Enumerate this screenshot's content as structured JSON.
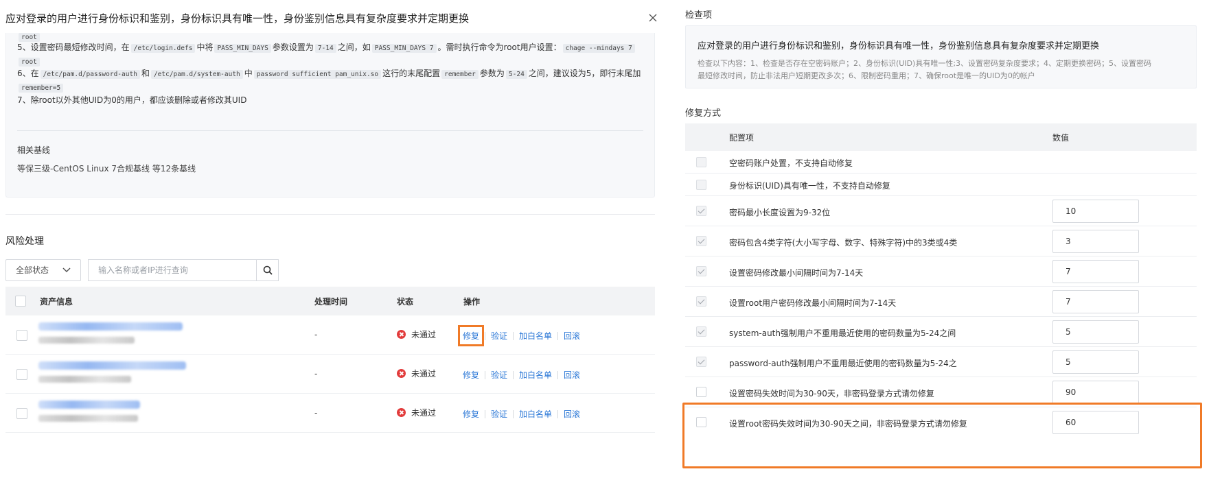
{
  "dialog": {
    "title": "应对登录的用户进行身份标识和鉴别，身份标识具有唯一性，身份鉴别信息具有复杂度要求并定期更换"
  },
  "description": {
    "line0_fragment": "root",
    "line5": {
      "p1": "5、设置密码最短修改时间，在",
      "c1": "/etc/login.defs",
      "p2": "中将",
      "c2": "PASS_MIN_DAYS",
      "p3": "参数设置为",
      "c3": "7-14",
      "p4": "之间，如",
      "c4": "PASS_MIN_DAYS 7",
      "p5": "。需时执行命令为root用户设置：",
      "c5": "chage --mindays 7",
      "c6": "root"
    },
    "line6": {
      "p1": "6、在",
      "c1": "/etc/pam.d/password-auth",
      "p2": "和",
      "c2": "/etc/pam.d/system-auth",
      "p3": "中",
      "c3": "password sufficient pam_unix.so",
      "p4": "这行的末尾配置",
      "c4": "remember",
      "p5": "参数为",
      "c5": "5-24",
      "p6": "之间，建议设为5，即行末尾加",
      "c6": "remember=5"
    },
    "line7": "7、除root以外其他UID为0的用户，都应该删除或者修改其UID",
    "baseline_title": "相关基线",
    "baseline_value": "等保三级-CentOS Linux 7合规基线 等12条基线"
  },
  "risk": {
    "title": "风险处理",
    "status_filter": "全部状态",
    "search_placeholder": "输入名称或者IP进行查询",
    "columns": [
      "资产信息",
      "处理时间",
      "状态",
      "操作"
    ],
    "rows": [
      {
        "time": "-",
        "status": "未通过"
      },
      {
        "time": "-",
        "status": "未通过"
      },
      {
        "time": "-",
        "status": "未通过"
      }
    ],
    "ops": [
      "修复",
      "验证",
      "加白名单",
      "回滚"
    ]
  },
  "check": {
    "section_label": "检查项",
    "title": "应对登录的用户进行身份标识和鉴别，身份标识具有唯一性，身份鉴别信息具有复杂度要求并定期更换",
    "desc_line1": "检查以下内容：1、检查是否存在空密码账户；2、身份标识(UID)具有唯一性;3、设置密码复杂度要求；4、定期更换密码；5、设置密码",
    "desc_line2": "最短修改时间，防止非法用户短期更改多次；6、限制密码重用；7、确保root是唯一的UID为0的帐户"
  },
  "fix": {
    "section_label": "修复方式",
    "col_item": "配置项",
    "col_value": "数值",
    "items": [
      {
        "label": "空密码账户处置，不支持自动修复",
        "value": "",
        "checked": false
      },
      {
        "label": "身份标识(UID)具有唯一性，不支持自动修复",
        "value": "",
        "checked": false
      },
      {
        "label": "密码最小长度设置为9-32位",
        "value": "10",
        "checked": true
      },
      {
        "label": "密码包含4类字符(大小写字母、数字、特殊字符)中的3类或4类",
        "value": "3",
        "checked": true
      },
      {
        "label": "设置密码修改最小间隔时间为7-14天",
        "value": "7",
        "checked": true
      },
      {
        "label": "设置root用户密码修改最小间隔时间为7-14天",
        "value": "7",
        "checked": true
      },
      {
        "label": "system-auth强制用户不重用最近使用的密码数量为5-24之间",
        "value": "5",
        "checked": true
      },
      {
        "label": "password-auth强制用户不重用最近使用的密码数量为5-24之",
        "value": "5",
        "checked": true
      },
      {
        "label": "设置密码失效时间为30-90天，非密码登录方式请勿修复",
        "value": "90",
        "checked": false
      },
      {
        "label": "设置root密码失效时间为30-90天之间，非密码登录方式请勿修复",
        "value": "60",
        "checked": false
      }
    ]
  }
}
